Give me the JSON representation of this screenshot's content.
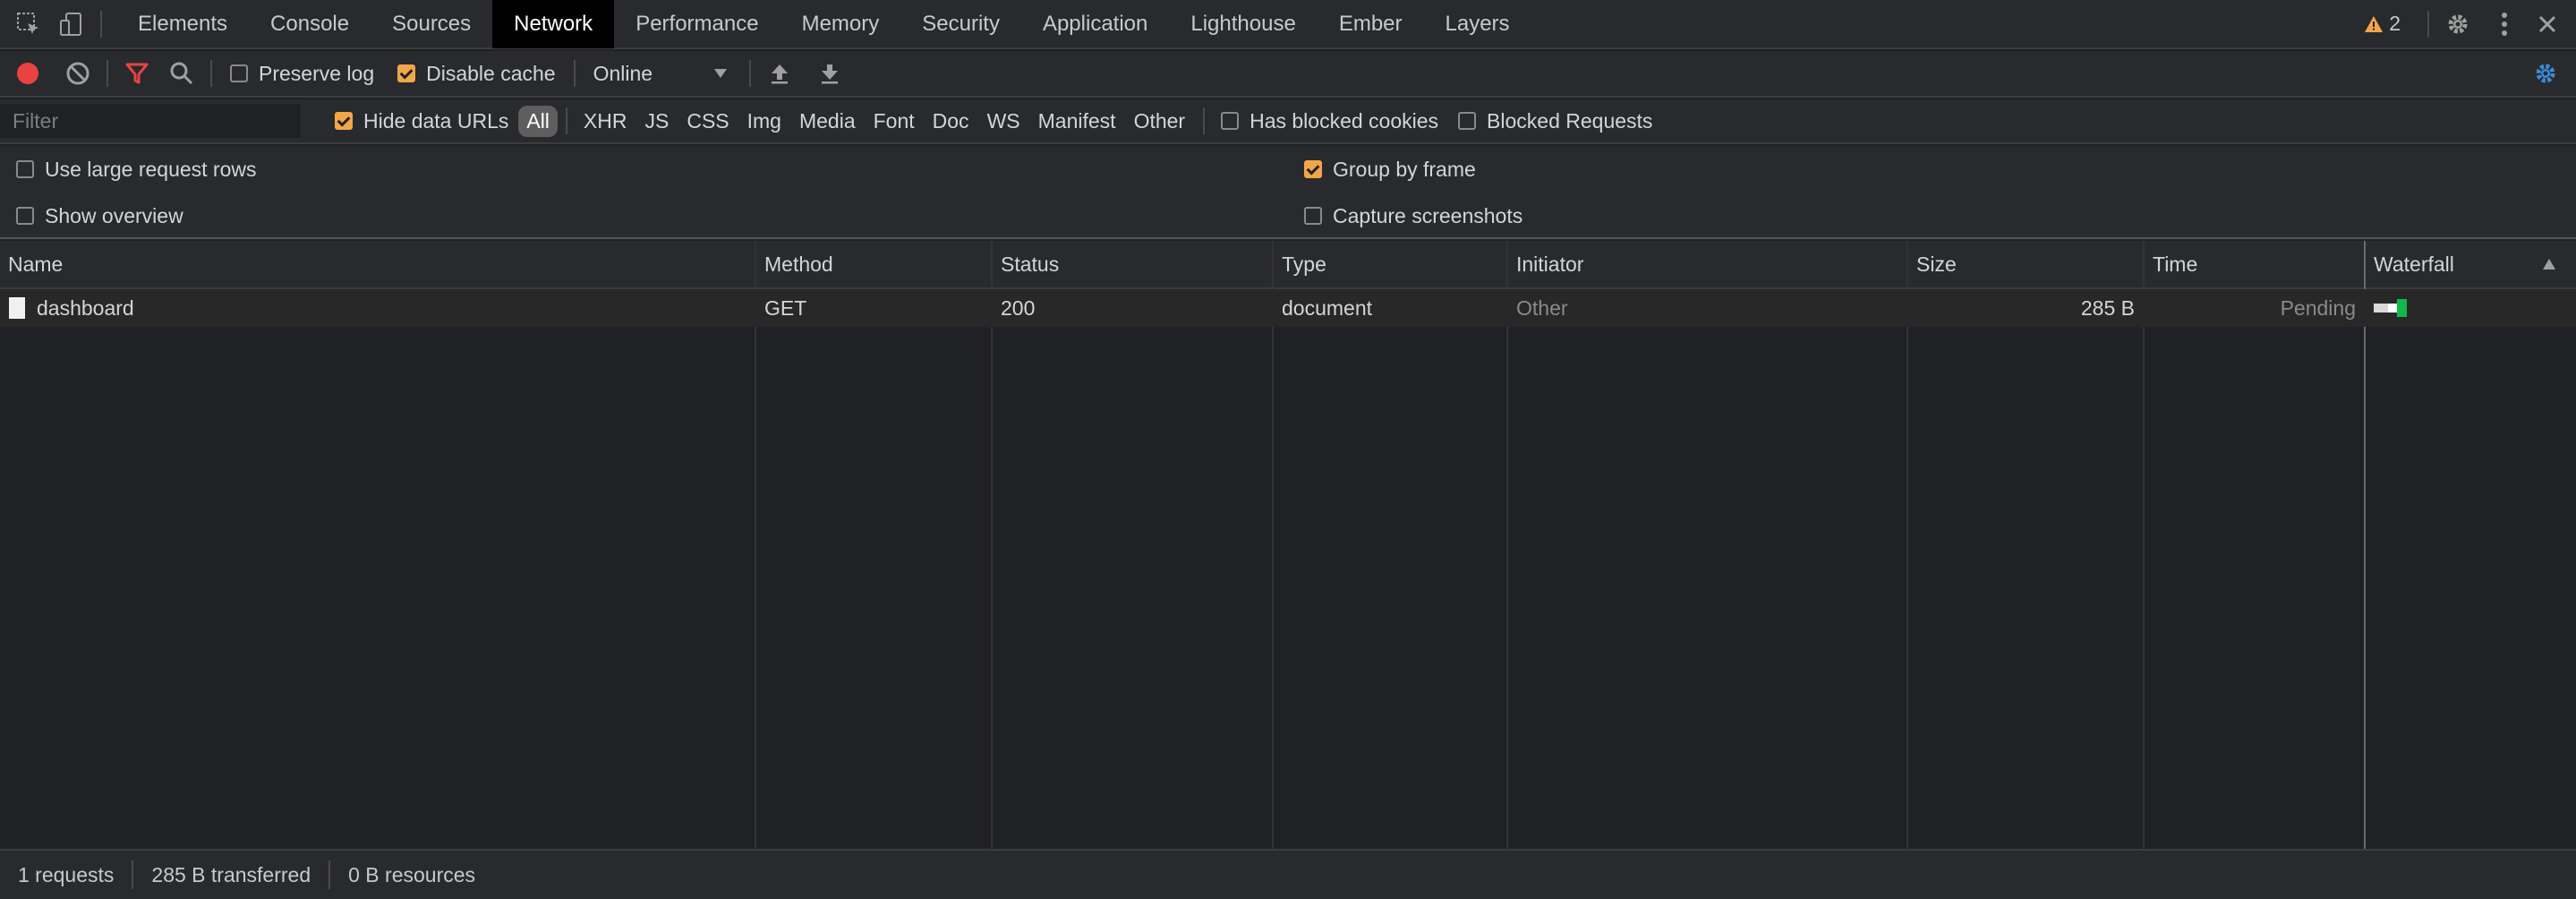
{
  "tabs": [
    "Elements",
    "Console",
    "Sources",
    "Network",
    "Performance",
    "Memory",
    "Security",
    "Application",
    "Lighthouse",
    "Ember",
    "Layers"
  ],
  "active_tab": "Network",
  "warnings": {
    "count": "2"
  },
  "toolbar": {
    "preserve_log": "Preserve log",
    "disable_cache": "Disable cache",
    "throttling": "Online"
  },
  "filter": {
    "placeholder": "Filter",
    "hide_data_urls": "Hide data URLs",
    "types": [
      "All",
      "XHR",
      "JS",
      "CSS",
      "Img",
      "Media",
      "Font",
      "Doc",
      "WS",
      "Manifest",
      "Other"
    ],
    "has_blocked_cookies": "Has blocked cookies",
    "blocked_requests": "Blocked Requests"
  },
  "settings": {
    "large_rows": "Use large request rows",
    "show_overview": "Show overview",
    "group_by_frame": "Group by frame",
    "capture_screenshots": "Capture screenshots"
  },
  "table": {
    "columns": [
      "Name",
      "Method",
      "Status",
      "Type",
      "Initiator",
      "Size",
      "Time",
      "Waterfall"
    ],
    "rows": [
      {
        "name": "dashboard",
        "method": "GET",
        "status": "200",
        "type": "document",
        "initiator": "Other",
        "size": "285 B",
        "time": "Pending"
      }
    ]
  },
  "status": {
    "requests": "1 requests",
    "transferred": "285 B transferred",
    "resources": "0 B resources"
  },
  "colors": {
    "accent": "#f2a64a",
    "record": "#e94242",
    "filter_icon": "#e94242",
    "settings_blue": "#3a8bd8",
    "waterfall_green": "#12b84a"
  }
}
